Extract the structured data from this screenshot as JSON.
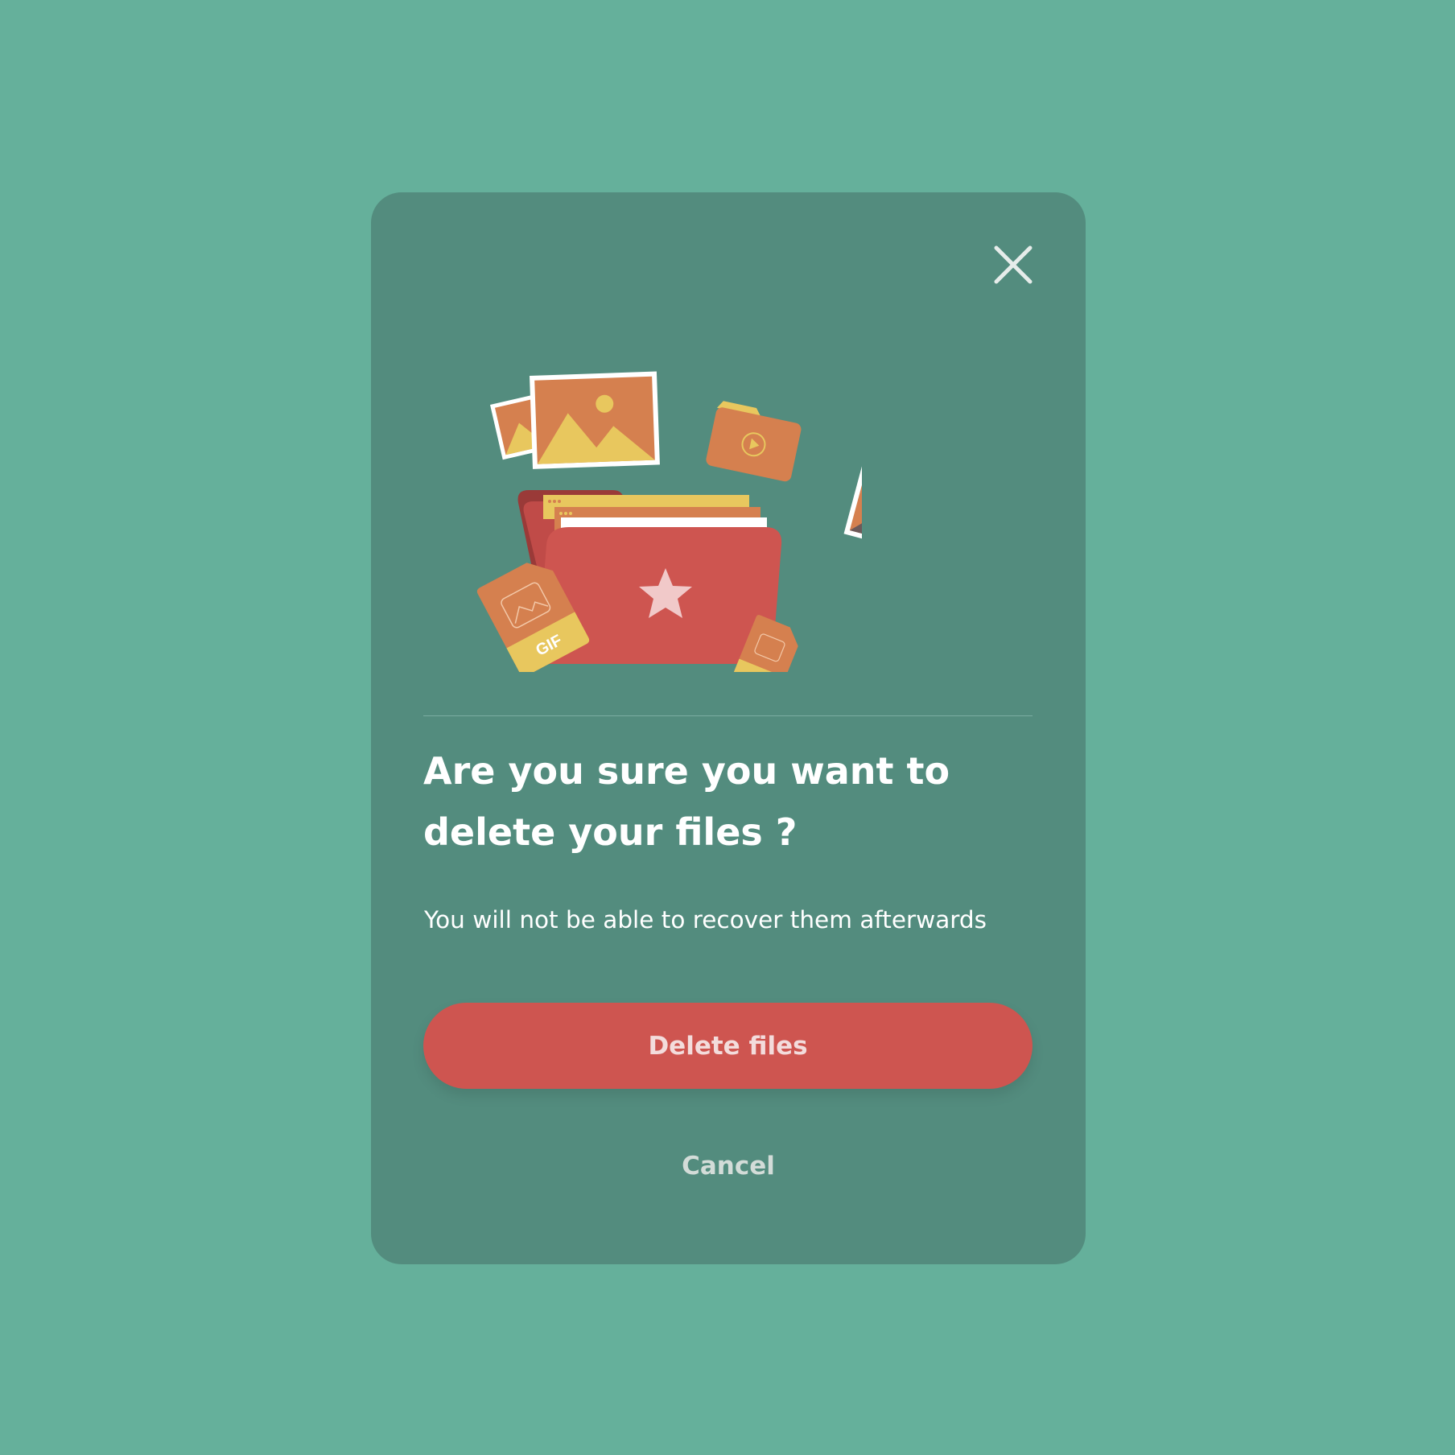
{
  "dialog": {
    "title": "Are you sure you want to delete your files ?",
    "message": "You will not be able to recover them afterwards",
    "primary_button_label": "Delete files",
    "secondary_button_label": "Cancel",
    "close_icon": "close-icon",
    "illustration": "files-folder-illustration",
    "gif_tag_label": "GIF"
  },
  "colors": {
    "background": "#65b09b",
    "dialog": "#538c7e",
    "danger": "#ce5550",
    "accent_orange": "#d5804f",
    "accent_yellow": "#e8c75e"
  }
}
